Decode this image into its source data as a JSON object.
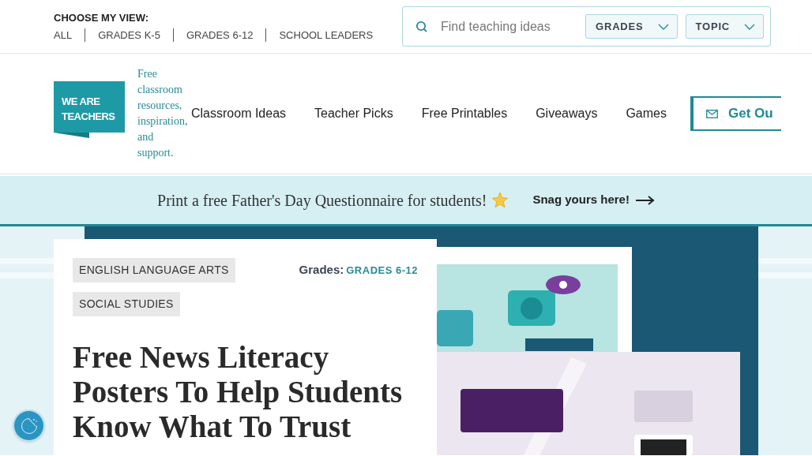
{
  "view_switcher": {
    "label": "CHOOSE MY VIEW:",
    "options": [
      {
        "label": "ALL",
        "selected": false
      },
      {
        "label": "GRADES K-5",
        "selected": false
      },
      {
        "label": "GRADES 6-12",
        "selected": false
      },
      {
        "label": "SCHOOL LEADERS",
        "selected": false
      }
    ]
  },
  "search": {
    "placeholder": "Find teaching ideas",
    "filters": [
      "GRADES",
      "TOPIC"
    ]
  },
  "logo": {
    "lines": [
      "WE ARE",
      "TEACHERS"
    ],
    "tagline": "Free classroom resources, inspiration, and support."
  },
  "nav": {
    "items": [
      "Classroom Ideas",
      "Teacher Picks",
      "Free Printables",
      "Giveaways",
      "Games"
    ],
    "cta": "Get Ou"
  },
  "banner": {
    "text": "Print a free Father's Day Questionnaire for students!",
    "link": "Snag yours here!"
  },
  "article": {
    "tags": [
      "ENGLISH LANGUAGE ARTS",
      "SOCIAL STUDIES"
    ],
    "grades_label": "Grades:",
    "grade": "GRADES 6-12",
    "title": "Free News Literacy Posters To Help Students Know What To Trust"
  }
}
